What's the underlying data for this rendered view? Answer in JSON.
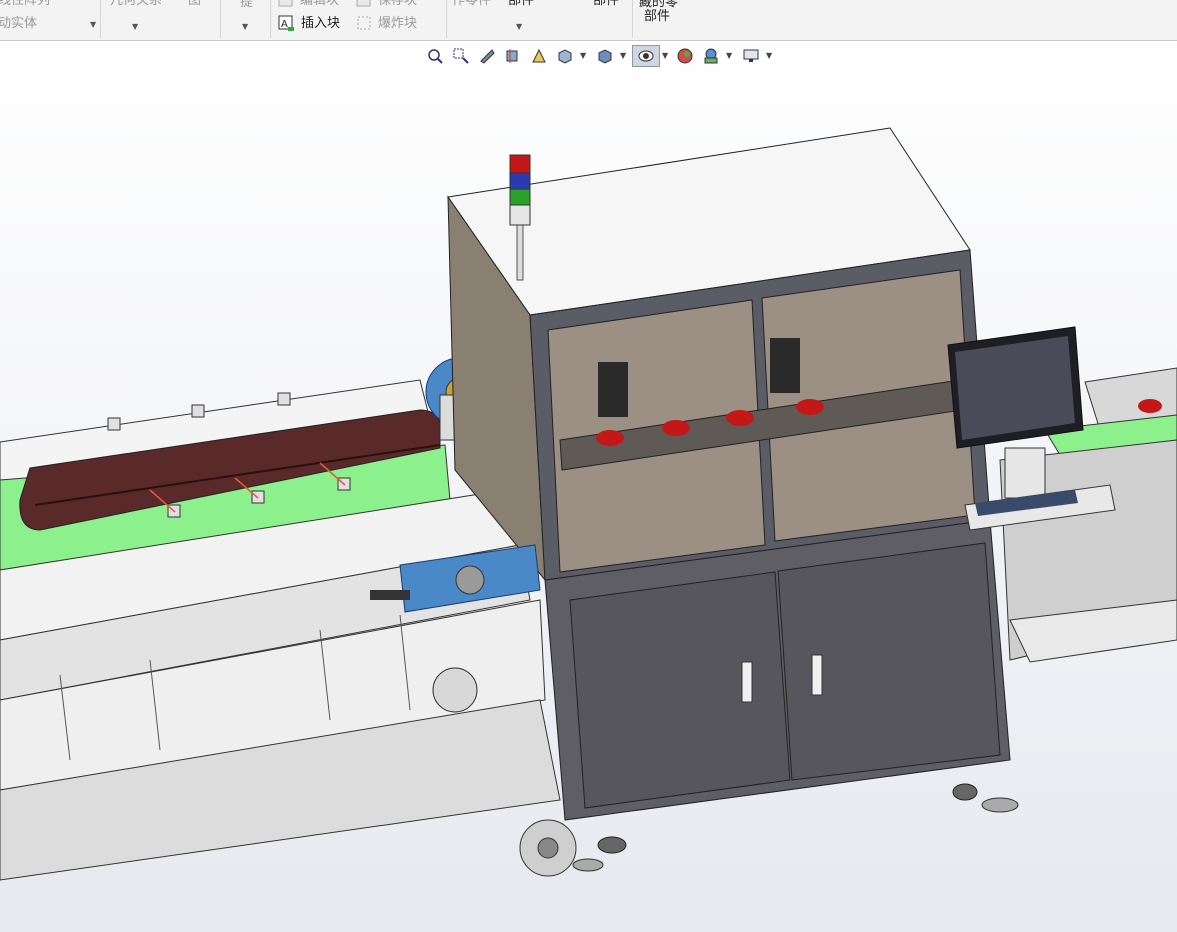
{
  "ribbon": {
    "row1": {
      "linear_pattern": "线性阵列",
      "relations": "几何关系",
      "view": "图",
      "hint": "提",
      "edit_block": "编辑块",
      "save_block": "保存块",
      "make_part": "作零件",
      "part_a": "部件",
      "part_b": "部件",
      "hidden_parts": "藏的零"
    },
    "row2": {
      "move_body": "动实体",
      "insert_block": "插入块",
      "explode_block": "爆炸块",
      "hidden_parts_2": "部件"
    }
  },
  "heads_up_toolbar": {
    "buttons": [
      {
        "icon": "zoom-to-fit-icon"
      },
      {
        "icon": "zoom-to-area-icon"
      },
      {
        "icon": "previous-view-icon"
      },
      {
        "icon": "section-view-icon"
      },
      {
        "icon": "dynamic-annotation-icon"
      },
      {
        "icon": "view-orientation-icon"
      },
      {
        "icon": "display-style-icon"
      },
      {
        "icon": "hide-show-items-icon"
      },
      {
        "icon": "edit-appearance-icon"
      },
      {
        "icon": "apply-scene-icon"
      },
      {
        "icon": "view-settings-icon"
      }
    ],
    "active": "hide-show-items-icon"
  },
  "model": {
    "description_none": "",
    "colors": {
      "frame": "#5b5d66",
      "cabinet": "#5e5e64",
      "panel": "#f2f2f2",
      "conveyor_belt": "#5a2a2a",
      "green_plate": "#8cf08c",
      "glass": "#9c8f84",
      "accent_blue": "#4a88c8",
      "red_parts": "#c41818"
    }
  }
}
